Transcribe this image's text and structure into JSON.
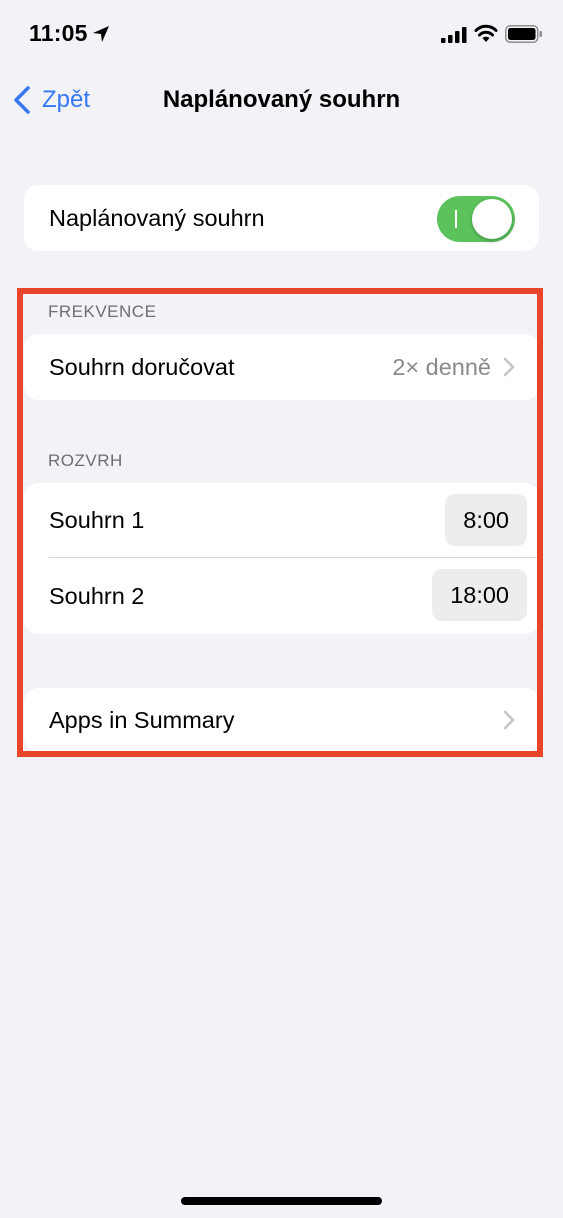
{
  "status": {
    "time": "11:05"
  },
  "nav": {
    "back_label": "Zpět",
    "title": "Naplánovaný souhrn"
  },
  "summary_toggle": {
    "label": "Naplánovaný souhrn",
    "enabled": true
  },
  "frequency": {
    "header": "FREKVENCE",
    "deliver_label": "Souhrn doručovat",
    "deliver_value": "2× denně"
  },
  "schedule": {
    "header": "ROZVRH",
    "items": [
      {
        "label": "Souhrn 1",
        "time": "8:00"
      },
      {
        "label": "Souhrn 2",
        "time": "18:00"
      }
    ]
  },
  "apps": {
    "label": "Apps in Summary"
  },
  "colors": {
    "accent": "#3478f6",
    "toggle_on": "#5cc35c",
    "highlight": "#e8442a",
    "background": "#f2f2f7"
  }
}
